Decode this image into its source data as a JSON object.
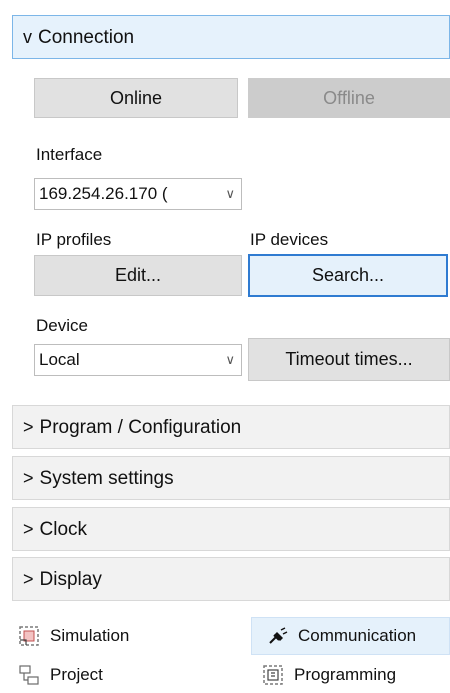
{
  "connection": {
    "header_label": "Connection",
    "header_chevron": "v",
    "online_label": "Online",
    "offline_label": "Offline",
    "interface_label": "Interface",
    "interface_value": "169.254.26.170 (",
    "ip_profiles_label": "IP profiles",
    "ip_devices_label": "IP devices",
    "edit_label": "Edit...",
    "search_label": "Search...",
    "device_label": "Device",
    "device_value": "Local",
    "timeout_label": "Timeout times..."
  },
  "sections": [
    {
      "chevron": ">",
      "label": "Program / Configuration"
    },
    {
      "chevron": ">",
      "label": "System settings"
    },
    {
      "chevron": ">",
      "label": "Clock"
    },
    {
      "chevron": ">",
      "label": "Display"
    }
  ],
  "nav": {
    "simulation_label": "Simulation",
    "communication_label": "Communication",
    "project_label": "Project",
    "programming_label": "Programming"
  },
  "colors": {
    "active_header_bg": "#e6f2fc",
    "active_header_border": "#7cb6e8",
    "focus_border": "#2f7bd1"
  }
}
